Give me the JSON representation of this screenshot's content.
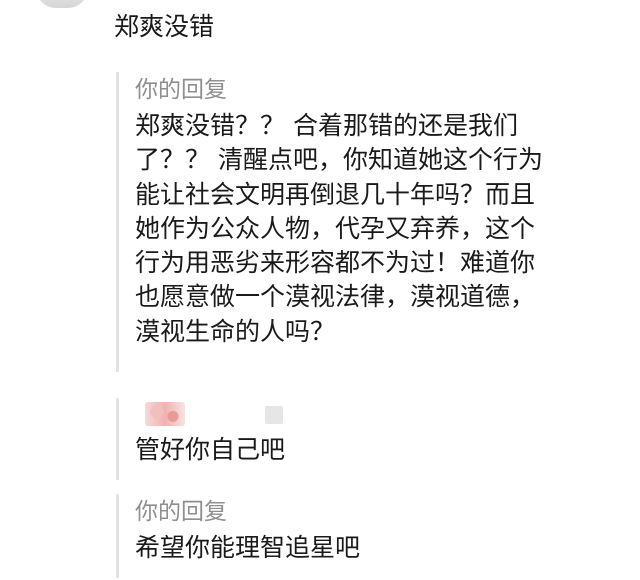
{
  "comment": {
    "text": "郑爽没错"
  },
  "replies": [
    {
      "label": "你的回复",
      "lines": [
        "郑爽没错？？ 合着那错的还是我们",
        "了？？ 清醒点吧，你知道她这个行为",
        "能让社会文明再倒退几十年吗？而且",
        "她作为公众人物，代孕又弃养，这个",
        "行为用恶劣来形容都不为过！难道你",
        "也愿意做一个漠视法律，漠视道德，",
        "漠视生命的人吗？"
      ]
    },
    {
      "text": "管好你自己吧"
    },
    {
      "label": "你的回复",
      "text": "希望你能理智追星吧"
    }
  ]
}
